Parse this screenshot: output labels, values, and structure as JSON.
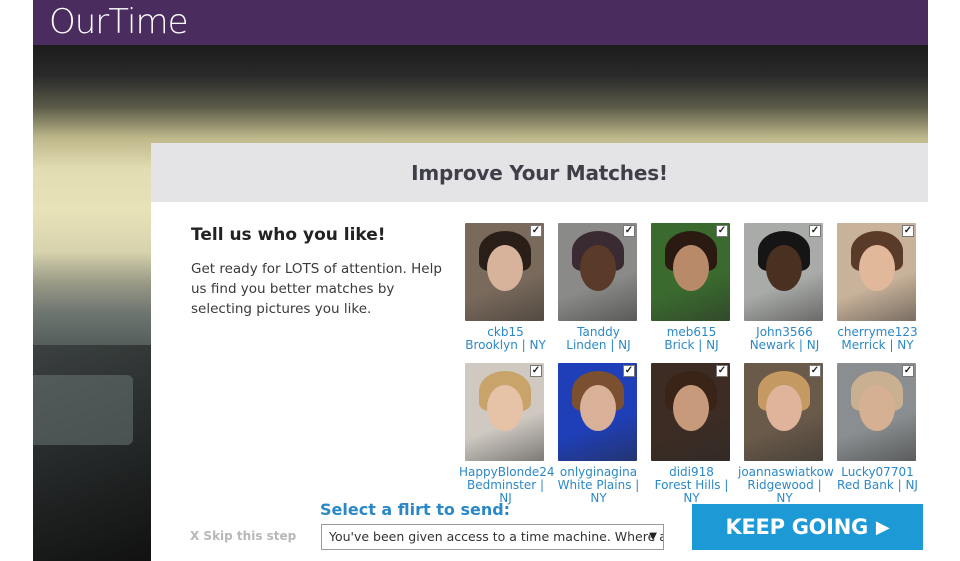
{
  "header": {
    "logo": "OurTime"
  },
  "modal": {
    "title": "Improve Your Matches!",
    "heading": "Tell us who you like!",
    "body": "Get ready for LOTS of attention. Help us find you better matches by selecting pictures you like."
  },
  "profiles": [
    {
      "name": "ckb15",
      "location": "Brooklyn | NY",
      "checked": true,
      "bg": "#7a6a5c",
      "skin": "#d8b39c",
      "hair": "#2a1e18"
    },
    {
      "name": "Tanddy",
      "location": "Linden | NJ",
      "checked": true,
      "bg": "#8a8a88",
      "skin": "#5a3a28",
      "hair": "#3a2a32"
    },
    {
      "name": "meb615",
      "location": "Brick | NJ",
      "checked": true,
      "bg": "#3a6a2e",
      "skin": "#b88a6a",
      "hair": "#2a1a12"
    },
    {
      "name": "John3566",
      "location": "Newark | NJ",
      "checked": true,
      "bg": "#a9aba8",
      "skin": "#4a3020",
      "hair": "#151515"
    },
    {
      "name": "cherryme123",
      "location": "Merrick | NY",
      "checked": true,
      "bg": "#c8b29a",
      "skin": "#e2b89a",
      "hair": "#5a3a28"
    },
    {
      "name": "HappyBlonde24",
      "location": "Bedminster | NJ",
      "checked": true,
      "bg": "#cfc9c2",
      "skin": "#e6c2a6",
      "hair": "#c9a46a"
    },
    {
      "name": "onlyginagina",
      "location": "White Plains | NY",
      "checked": true,
      "bg": "#1e3fb8",
      "skin": "#d9b098",
      "hair": "#7a5030"
    },
    {
      "name": "didi918",
      "location": "Forest Hills | NY",
      "checked": true,
      "bg": "#3c2c24",
      "skin": "#c89a7c",
      "hair": "#3a2418"
    },
    {
      "name": "joannaswiatkow",
      "location": "Ridgewood | NY",
      "checked": true,
      "bg": "#6a5a4a",
      "skin": "#e0b49a",
      "hair": "#c49a62"
    },
    {
      "name": "Lucky07701",
      "location": "Red Bank | NJ",
      "checked": true,
      "bg": "#8a8e90",
      "skin": "#d6b092",
      "hair": "#c8b090"
    }
  ],
  "footer": {
    "skip_label": "X Skip this step",
    "flirt_label": "Select a flirt to send:",
    "flirt_value": "You've been given access to a time machine. Where and when would you go?",
    "caret": "▼",
    "keep_label": "KEEP GOING",
    "keep_arrow": "▶"
  },
  "colors": {
    "accent": "#1d9ad6",
    "link": "#2b88c8",
    "brand": "#4a2d5e"
  }
}
